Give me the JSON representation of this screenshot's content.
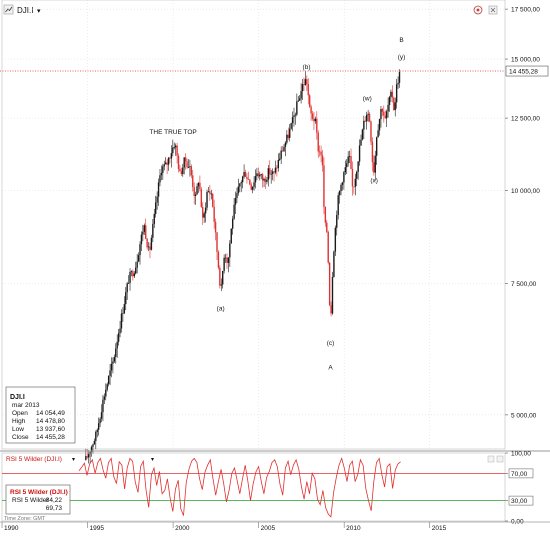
{
  "toolbar": {
    "symbol": "DJI.I",
    "dropdown_glyph": "▾",
    "settings_icon": "gear-icon",
    "close_icon": "close-icon"
  },
  "colors": {
    "candle_up": "#1a1a1a",
    "candle_down": "#e03030",
    "rsi_line": "#e03030",
    "level_line": "#e03030",
    "level_line_green": "#28a028",
    "grid": "#d8d8d8",
    "price_tag_bg": "#ffffff",
    "rsi_label": "#cc1111"
  },
  "chart_data": [
    {
      "type": "candlestick",
      "title": "DJI.I",
      "scale": "log",
      "ylim": [
        4500,
        18000
      ],
      "yticks": [
        "17 500,00",
        "15 000,00",
        "12 500,00",
        "10 000,00",
        "7 500,00",
        "5 000,00"
      ],
      "ytick_values": [
        17500,
        15000,
        12500,
        10000,
        7500,
        5000
      ],
      "xlim": [
        1990.0,
        2019.4
      ],
      "xticks": [
        "1990",
        "1995",
        "2000",
        "2005",
        "2010",
        "2015"
      ],
      "xtick_values": [
        1990,
        1995,
        2000,
        2005,
        2010,
        2015
      ],
      "last_price_label": "14 455,28",
      "last_price": 14455.28,
      "path": [
        [
          1994.9,
          4350
        ],
        [
          1995.5,
          4700
        ],
        [
          1996.0,
          5350
        ],
        [
          1996.5,
          5900
        ],
        [
          1997.0,
          6800
        ],
        [
          1997.4,
          7600
        ],
        [
          1997.8,
          7900
        ],
        [
          1998.3,
          9000
        ],
        [
          1998.6,
          8200
        ],
        [
          1998.9,
          9200
        ],
        [
          1999.3,
          10700
        ],
        [
          1999.6,
          10800
        ],
        [
          1999.9,
          11300
        ],
        [
          2000.1,
          11600
        ],
        [
          2000.4,
          10500
        ],
        [
          2000.7,
          11000
        ],
        [
          2001.0,
          10700
        ],
        [
          2001.3,
          9700
        ],
        [
          2001.5,
          10400
        ],
        [
          2001.75,
          9000
        ],
        [
          2002.0,
          10000
        ],
        [
          2002.25,
          9900
        ],
        [
          2002.5,
          8600
        ],
        [
          2002.7,
          7700
        ],
        [
          2002.8,
          7300
        ],
        [
          2003.0,
          8300
        ],
        [
          2003.2,
          8000
        ],
        [
          2003.5,
          9300
        ],
        [
          2003.9,
          10200
        ],
        [
          2004.2,
          10600
        ],
        [
          2004.6,
          10100
        ],
        [
          2004.9,
          10600
        ],
        [
          2005.3,
          10300
        ],
        [
          2005.6,
          10600
        ],
        [
          2005.9,
          10500
        ],
        [
          2006.3,
          11200
        ],
        [
          2006.7,
          11800
        ],
        [
          2007.0,
          12400
        ],
        [
          2007.4,
          13400
        ],
        [
          2007.6,
          13900
        ],
        [
          2007.8,
          14100
        ],
        [
          2008.0,
          12700
        ],
        [
          2008.3,
          12400
        ],
        [
          2008.5,
          11300
        ],
        [
          2008.7,
          11200
        ],
        [
          2008.85,
          9000
        ],
        [
          2009.0,
          8800
        ],
        [
          2009.15,
          7100
        ],
        [
          2009.2,
          6550
        ],
        [
          2009.35,
          8100
        ],
        [
          2009.6,
          9600
        ],
        [
          2009.9,
          10400
        ],
        [
          2010.3,
          11100
        ],
        [
          2010.5,
          10000
        ],
        [
          2010.7,
          10600
        ],
        [
          2010.9,
          11400
        ],
        [
          2011.15,
          12300
        ],
        [
          2011.35,
          12800
        ],
        [
          2011.5,
          12400
        ],
        [
          2011.65,
          11000
        ],
        [
          2011.75,
          10600
        ],
        [
          2011.9,
          11900
        ],
        [
          2012.2,
          13000
        ],
        [
          2012.4,
          12400
        ],
        [
          2012.6,
          13100
        ],
        [
          2012.8,
          13500
        ],
        [
          2012.92,
          12800
        ],
        [
          2013.1,
          14000
        ],
        [
          2013.3,
          14455.28
        ]
      ],
      "annotations": [
        {
          "text": "THE TRUE TOP",
          "x": 2000.0,
          "y": 11900
        },
        {
          "text": "(a)",
          "x": 2002.78,
          "y": 6900
        },
        {
          "text": "(b)",
          "x": 2007.8,
          "y": 14550
        },
        {
          "text": "(c)",
          "x": 2009.2,
          "y": 6200
        },
        {
          "text": "A",
          "x": 2009.2,
          "y": 5750
        },
        {
          "text": "(w)",
          "x": 2011.35,
          "y": 13200
        },
        {
          "text": "(x)",
          "x": 2011.75,
          "y": 10250
        },
        {
          "text": "(y)",
          "x": 2013.35,
          "y": 15000
        },
        {
          "text": "B",
          "x": 2013.35,
          "y": 15800
        }
      ]
    },
    {
      "type": "line",
      "title": "RSI 5 Wilder (DJI.I)",
      "ylim": [
        0,
        100
      ],
      "yticks": [
        "100,00",
        "70,00",
        "30,00",
        "0,00"
      ],
      "ytick_values": [
        100,
        70,
        30,
        0
      ],
      "levels": [
        70,
        30
      ],
      "values": [
        74,
        79,
        85,
        67,
        84,
        90,
        70,
        86,
        92,
        75,
        63,
        86,
        92,
        65,
        55,
        87,
        82,
        47,
        78,
        92,
        88,
        57,
        42,
        80,
        88,
        46,
        20,
        68,
        78,
        52,
        73,
        40,
        45,
        62,
        34,
        14,
        47,
        60,
        18,
        8,
        56,
        76,
        88,
        92,
        86,
        62,
        46,
        72,
        82,
        90,
        62,
        38,
        58,
        76,
        55,
        28,
        45,
        70,
        78,
        60,
        40,
        62,
        82,
        58,
        30,
        55,
        72,
        80,
        58,
        40,
        64,
        73,
        86,
        90,
        80,
        54,
        38,
        78,
        88,
        68,
        82,
        90,
        76,
        50,
        32,
        58,
        40,
        70,
        62,
        32,
        24,
        45,
        20,
        10,
        6,
        42,
        64,
        82,
        92,
        78,
        58,
        82,
        88,
        58,
        68,
        90,
        82,
        48,
        30,
        15,
        58,
        86,
        92,
        68,
        50,
        80,
        84,
        48,
        75,
        84,
        87
      ]
    }
  ],
  "info_box": {
    "symbol": "DJI.I",
    "date": "mar 2013",
    "rows": [
      {
        "label": "Open",
        "value": "14 054,49"
      },
      {
        "label": "High",
        "value": "14 478,80"
      },
      {
        "label": "Low",
        "value": "13 937,60"
      },
      {
        "label": "Close",
        "value": "14 455,28"
      }
    ]
  },
  "rsi_panel": {
    "title": "RSI 5 Wilder (DJI.I)",
    "legend_title": "RSI 5 Wilder (DJI.I)",
    "legend_label": "RSI 5 Wilder",
    "legend_value": "84,22",
    "second_value": "69,73"
  },
  "footer": {
    "timezone": "Time Zone: GMT"
  }
}
